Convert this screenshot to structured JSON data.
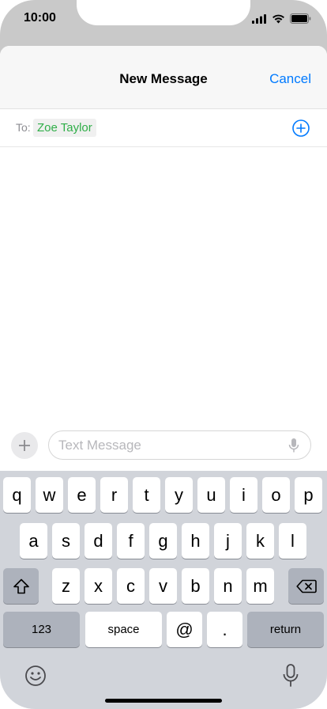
{
  "status_bar": {
    "time": "10:00"
  },
  "nav": {
    "title": "New Message",
    "cancel_label": "Cancel"
  },
  "recipient": {
    "to_label": "To:",
    "name": "Zoe Taylor"
  },
  "compose": {
    "placeholder": "Text Message"
  },
  "keyboard": {
    "row1": [
      "q",
      "w",
      "e",
      "r",
      "t",
      "y",
      "u",
      "i",
      "o",
      "p"
    ],
    "row2": [
      "a",
      "s",
      "d",
      "f",
      "g",
      "h",
      "j",
      "k",
      "l"
    ],
    "row3": [
      "z",
      "x",
      "c",
      "v",
      "b",
      "n",
      "m"
    ],
    "numbers_label": "123",
    "space_label": "space",
    "at_label": "@",
    "period_label": ".",
    "return_label": "return"
  },
  "colors": {
    "accent": "#007aff",
    "recipient": "#2fae48",
    "keyboard_bg": "#d1d4da"
  }
}
